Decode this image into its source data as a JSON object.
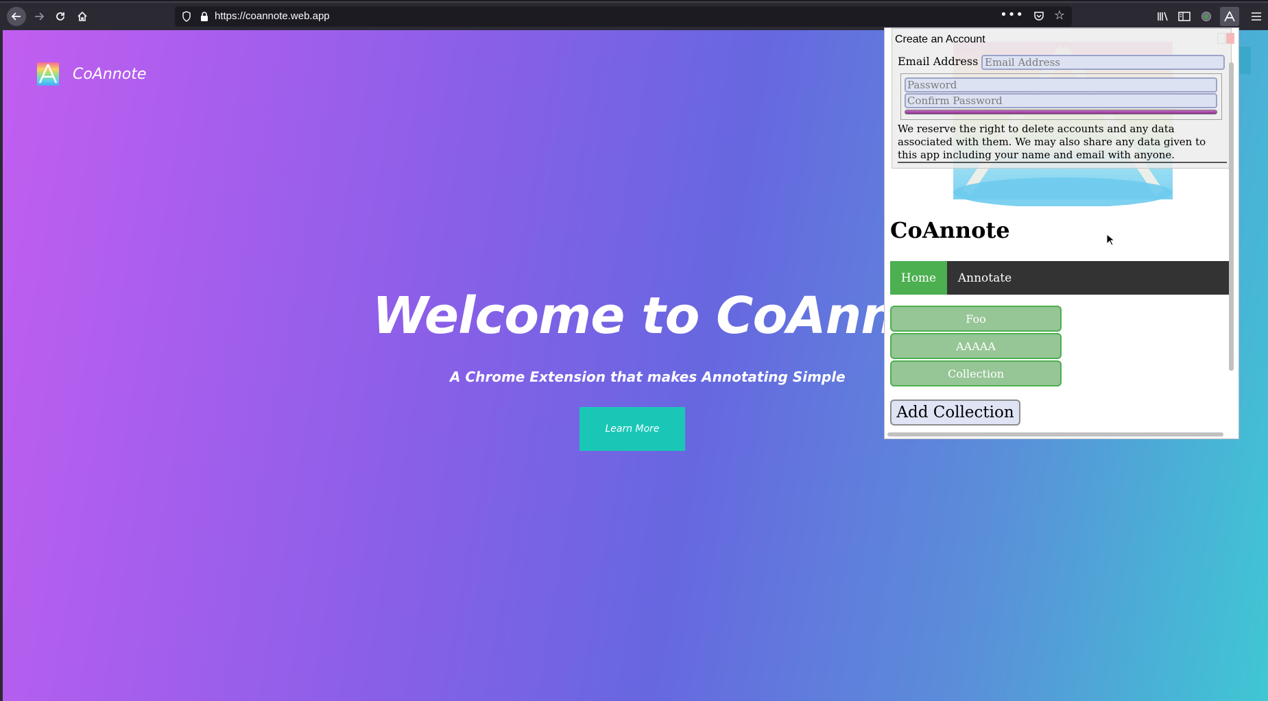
{
  "browser": {
    "url": "https://coannote.web.app",
    "more_label": "•••"
  },
  "page": {
    "brand_name": "CoAnnote",
    "hero_title": "Welcome to CoAnnote",
    "hero_subtitle": "A Chrome Extension that makes Annotating Simple",
    "learn_more": "Learn More"
  },
  "popup": {
    "dialog": {
      "title": "Create an Account",
      "email_label": "Email Address",
      "email_placeholder": "Email Address",
      "password_placeholder": "Password",
      "confirm_placeholder": "Confirm Password",
      "disclaimer": "We reserve the right to delete accounts and any data associated with them. We may also share any data given to this app including your name and email with anyone."
    },
    "title": "CoAnnote",
    "menu": {
      "home": "Home",
      "annotate": "Annotate"
    },
    "collections": [
      "Foo",
      "AAAAA",
      "Collection"
    ],
    "add_collection": "Add Collection"
  },
  "colors": {
    "menu_active": "#4caf50",
    "menu_bg": "#333333",
    "learn_more_bg": "#1ac7b7",
    "collection_btn": "#96c596"
  }
}
